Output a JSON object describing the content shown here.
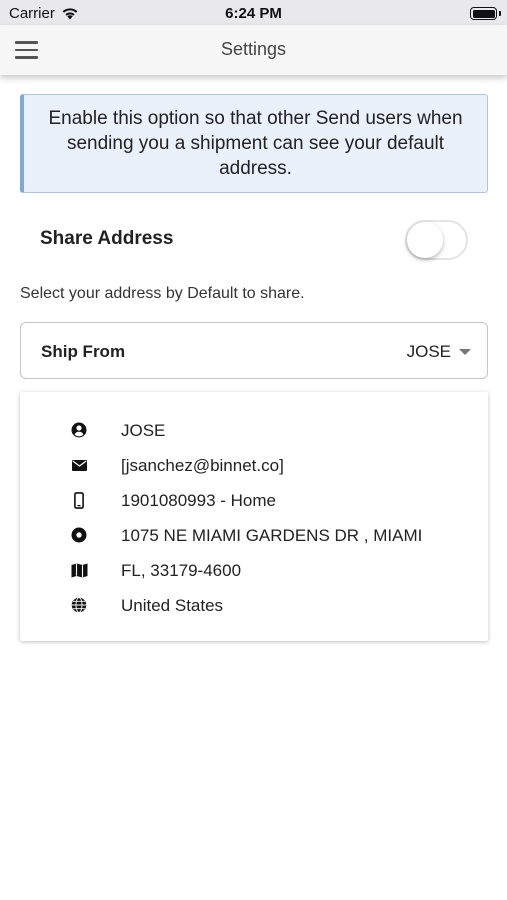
{
  "status_bar": {
    "carrier": "Carrier",
    "time": "6:24 PM",
    "icons": [
      "wifi-icon",
      "battery-icon"
    ]
  },
  "app_bar": {
    "title": "Settings",
    "menu_icon": "hamburger-menu-icon"
  },
  "info": {
    "text": "Enable this option so that other Send users when sending you a shipment can see your default address."
  },
  "share": {
    "label": "Share Address",
    "enabled": false
  },
  "select_hint": "Select your address by Default to share.",
  "ship_from": {
    "label": "Ship From",
    "selected": "JOSE",
    "caret_icon": "caret-down-icon"
  },
  "address": {
    "rows": [
      {
        "icon": "user-icon",
        "text": "JOSE"
      },
      {
        "icon": "envelope-icon",
        "text": "[jsanchez@binnet.co]"
      },
      {
        "icon": "mobile-phone-icon",
        "text": "1901080993 - Home"
      },
      {
        "icon": "location-dot-icon",
        "text": "1075 NE MIAMI GARDENS DR , MIAMI"
      },
      {
        "icon": "map-icon",
        "text": "FL, 33179-4600"
      },
      {
        "icon": "globe-icon",
        "text": "United States"
      }
    ]
  },
  "colors": {
    "info_background": "#eaf1fb",
    "info_accent": "#7fa7d8",
    "toggle_off": "#ffffff"
  }
}
